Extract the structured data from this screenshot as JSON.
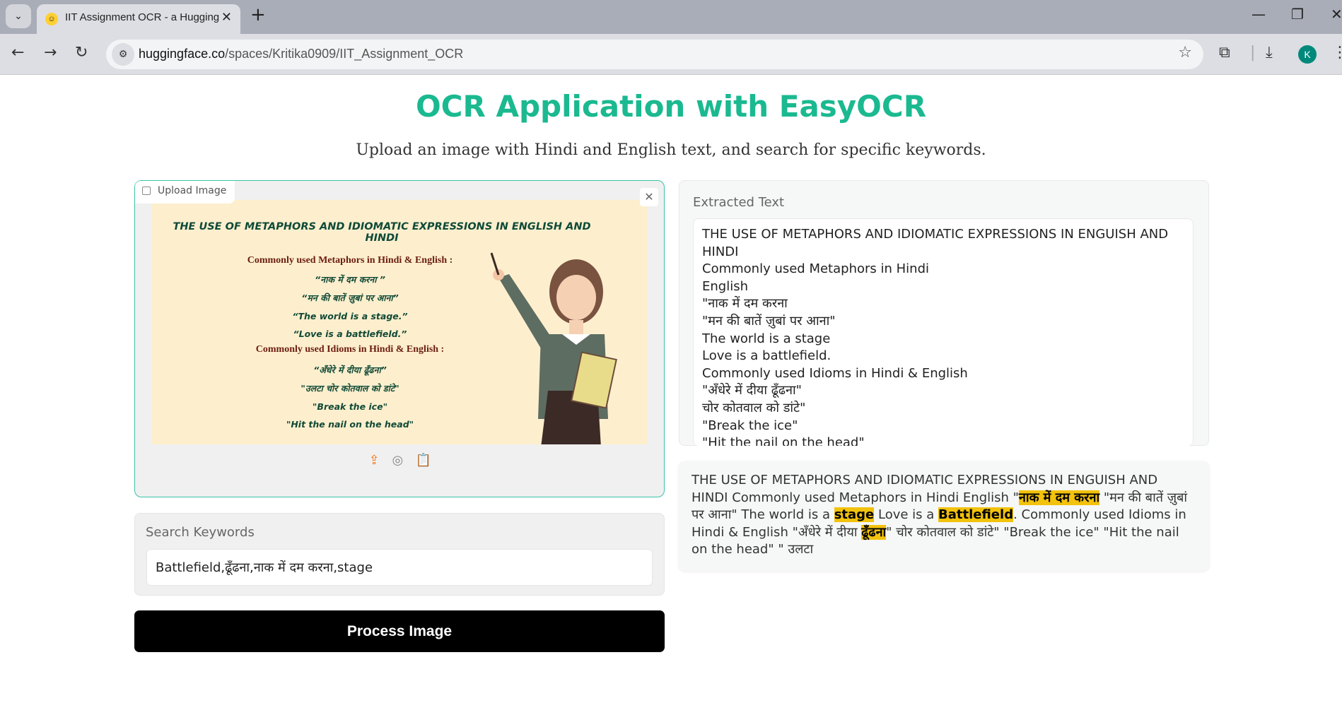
{
  "browser": {
    "tab_title": "IIT Assignment OCR - a Hugging",
    "url_domain": "huggingface.co",
    "url_path": "/spaces/Kritika0909/IIT_Assignment_OCR",
    "avatar_letter": "K"
  },
  "page": {
    "title": "OCR Application with EasyOCR",
    "subtitle": "Upload an image with Hindi and English text, and search for specific keywords."
  },
  "upload": {
    "label": "Upload Image",
    "image_text": {
      "heading": "THE USE OF METAPHORS AND IDIOMATIC EXPRESSIONS IN ENGLISH AND HINDI",
      "lines": [
        "Commonly used Metaphors in Hindi & English :",
        "“नाक में दम करना ”",
        "“मन की बातें ज़ुबां पर आना”",
        "“The world is a stage.”",
        "“Love is a battlefield.”",
        "Commonly used Idioms in Hindi & English :",
        "“अँधेरे में दीया ढूँढना”",
        "\"उलटा चोर कोतवाल को डांटे\"",
        "\"Break the ice\"",
        "\"Hit the nail on the head\""
      ]
    }
  },
  "search": {
    "label": "Search Keywords",
    "value": "Battlefield,ढूँढना,नाक में दम करना,stage"
  },
  "process_button": "Process Image",
  "extracted": {
    "label": "Extracted Text",
    "value": "THE USE OF METAPHORS AND IDIOMATIC EXPRESSIONS IN ENGUISH AND HINDI\nCommonly used Metaphors in Hindi\nEnglish\n\"नाक में दम करना\n\"मन की बातें ज़ुबां पर आना\"\nThe world is a stage\nLove is a battlefield.\nCommonly used Idioms in Hindi & English\n\"अँधेरे में दीया ढूँढना\"\nचोर कोतवाल को डांटे\"\n\"Break the ice\"\n\"Hit the nail on the head\"\n\" उलटा"
  },
  "highlighted": {
    "segments": [
      {
        "text": "THE USE OF METAPHORS AND IDIOMATIC EXPRESSIONS IN ENGUISH AND HINDI Commonly used Metaphors in Hindi English \"",
        "highlight": false
      },
      {
        "text": "नाक में दम करना",
        "highlight": true
      },
      {
        "text": " \"मन की बातें ज़ुबां पर आना\" The world is a ",
        "highlight": false
      },
      {
        "text": "stage",
        "highlight": true
      },
      {
        "text": " Love is a ",
        "highlight": false
      },
      {
        "text": "Battlefield",
        "highlight": true
      },
      {
        "text": ". Commonly used Idioms in Hindi & English \"अँधेरे में दीया ",
        "highlight": false
      },
      {
        "text": "ढूँढना",
        "highlight": true
      },
      {
        "text": "\" चोर कोतवाल को डांटे\" \"Break the ice\" \"Hit the nail on the head\" \" उलटा",
        "highlight": false
      }
    ],
    "highlight_color": "#f2c20c"
  },
  "colors": {
    "accent": "#1bb990",
    "button": "#000000"
  }
}
